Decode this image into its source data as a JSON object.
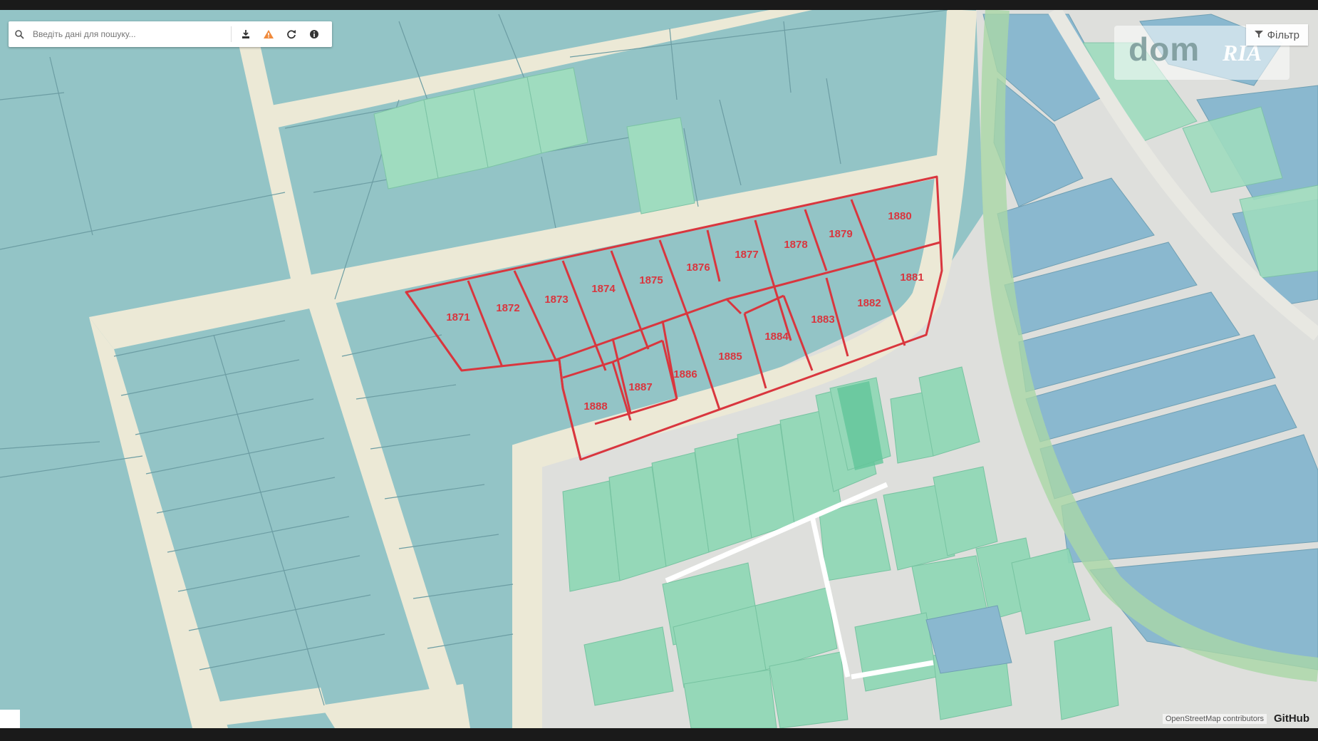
{
  "search": {
    "placeholder": "Введіть дані для пошуку..."
  },
  "toolbar": {
    "download_icon": "download-icon",
    "warning_icon": "warning-icon",
    "refresh_icon": "refresh-icon",
    "info_icon": "info-icon"
  },
  "filter": {
    "label": "Фільтр"
  },
  "watermark": {
    "brand": "dom",
    "suffix": "RIA"
  },
  "attribution": {
    "osm": "OpenStreetMap contributors",
    "github": "GitHub"
  },
  "colors": {
    "parcel_outline": "#d9363e",
    "parcel_fill": "#93c4c6",
    "road": "#ece9d6",
    "green_parcel": "#9fdcbf"
  },
  "plots": [
    {
      "id": "plot-1871",
      "label": "1871"
    },
    {
      "id": "plot-1872",
      "label": "1872"
    },
    {
      "id": "plot-1873",
      "label": "1873"
    },
    {
      "id": "plot-1874",
      "label": "1874"
    },
    {
      "id": "plot-1875",
      "label": "1875"
    },
    {
      "id": "plot-1876",
      "label": "1876"
    },
    {
      "id": "plot-1877",
      "label": "1877"
    },
    {
      "id": "plot-1878",
      "label": "1878"
    },
    {
      "id": "plot-1879",
      "label": "1879"
    },
    {
      "id": "plot-1880",
      "label": "1880"
    },
    {
      "id": "plot-1881",
      "label": "1881"
    },
    {
      "id": "plot-1882",
      "label": "1882"
    },
    {
      "id": "plot-1883",
      "label": "1883"
    },
    {
      "id": "plot-1884",
      "label": "1884"
    },
    {
      "id": "plot-1885",
      "label": "1885"
    },
    {
      "id": "plot-1886",
      "label": "1886"
    },
    {
      "id": "plot-1887",
      "label": "1887"
    },
    {
      "id": "plot-1888",
      "label": "1888"
    }
  ]
}
